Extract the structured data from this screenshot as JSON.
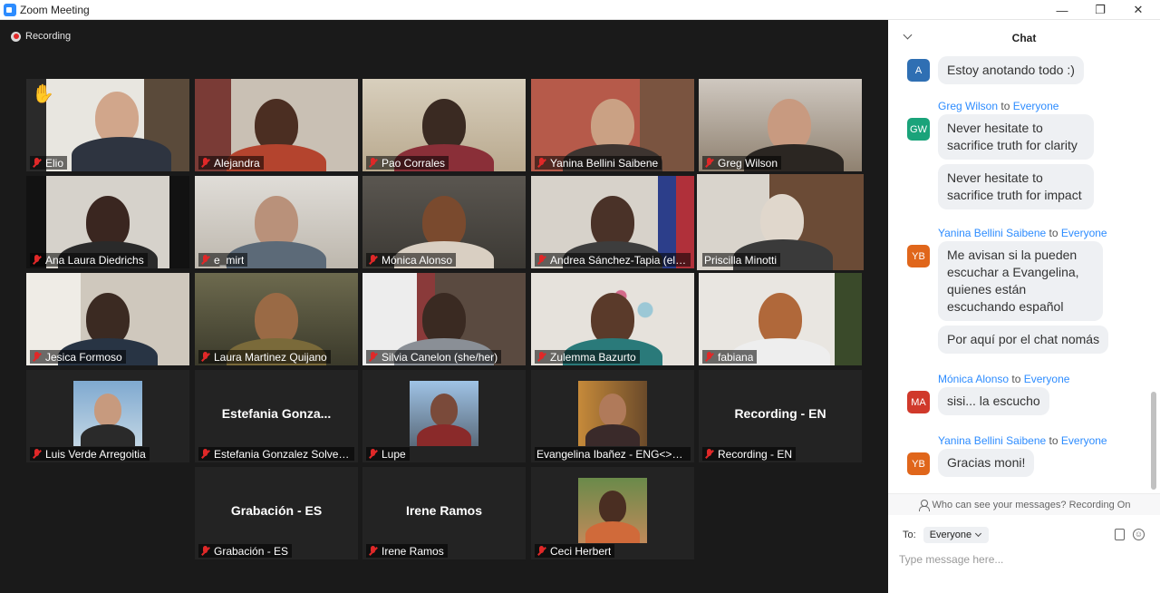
{
  "window": {
    "title": "Zoom Meeting",
    "minimize": "—",
    "maximize": "❐",
    "close": "✕"
  },
  "meeting": {
    "recording_label": "Recording",
    "participants": [
      {
        "name": "Elio",
        "hand_raised": true
      },
      {
        "name": "Alejandra"
      },
      {
        "name": "Pao Corrales"
      },
      {
        "name": "Yanina Bellini Saibene"
      },
      {
        "name": "Greg Wilson"
      },
      {
        "name": "Ana Laura Diedrichs"
      },
      {
        "name": "e_mirt"
      },
      {
        "name": "Mónica Alonso"
      },
      {
        "name": "Andrea Sánchez-Tapia (ella..."
      },
      {
        "name": "Priscilla Minotti",
        "active_speaker": true
      },
      {
        "name": "Jesica Formoso"
      },
      {
        "name": "Laura Martinez Quijano"
      },
      {
        "name": "Silvia Canelon (she/her)"
      },
      {
        "name": "Zulemma Bazurto"
      },
      {
        "name": "fabiana"
      },
      {
        "name": "Luis Verde Arregoitia"
      },
      {
        "name": "Estefania Gonzalez Solveyra",
        "display_name": "Estefania  Gonza..."
      },
      {
        "name": "Lupe"
      },
      {
        "name": "Evangelina Ibañez - ENG<>SP..."
      },
      {
        "name": "Recording - EN",
        "display_name": "Recording - EN"
      },
      {
        "name": "Grabación - ES",
        "display_name": "Grabación - ES"
      },
      {
        "name": "Irene Ramos",
        "display_name": "Irene Ramos"
      },
      {
        "name": "Ceci Herbert"
      }
    ]
  },
  "chat": {
    "title": "Chat",
    "messages": [
      {
        "initials": "A",
        "avatar_color": "#2f6fb3",
        "text": "Estoy anotando todo :)"
      },
      {
        "sender": "Greg Wilson",
        "to_word": "to",
        "recipient": "Everyone",
        "initials": "GW",
        "avatar_color": "#1aa37a",
        "texts": [
          "Never hesitate to sacrifice truth for clarity",
          "Never hesitate to sacrifice truth for impact"
        ]
      },
      {
        "sender": "Yanina Bellini Saibene",
        "to_word": "to",
        "recipient": "Everyone",
        "initials": "YB",
        "avatar_color": "#e0661b",
        "texts": [
          "Me avisan si la pueden escuchar a Evangelina, quienes están escuchando español",
          "Por aquí por el chat nomás"
        ]
      },
      {
        "sender": "Mónica Alonso",
        "to_word": "to",
        "recipient": "Everyone",
        "initials": "MA",
        "avatar_color": "#d0392b",
        "texts": [
          "sisi... la escucho"
        ]
      },
      {
        "sender": "Yanina Bellini Saibene",
        "to_word": "to",
        "recipient": "Everyone",
        "initials": "YB",
        "avatar_color": "#e0661b",
        "texts": [
          "Gracias moni!"
        ]
      }
    ],
    "visibility_note": "Who can see your messages? Recording On",
    "to_label": "To:",
    "recipient_select": "Everyone",
    "input_placeholder": "Type message here..."
  }
}
